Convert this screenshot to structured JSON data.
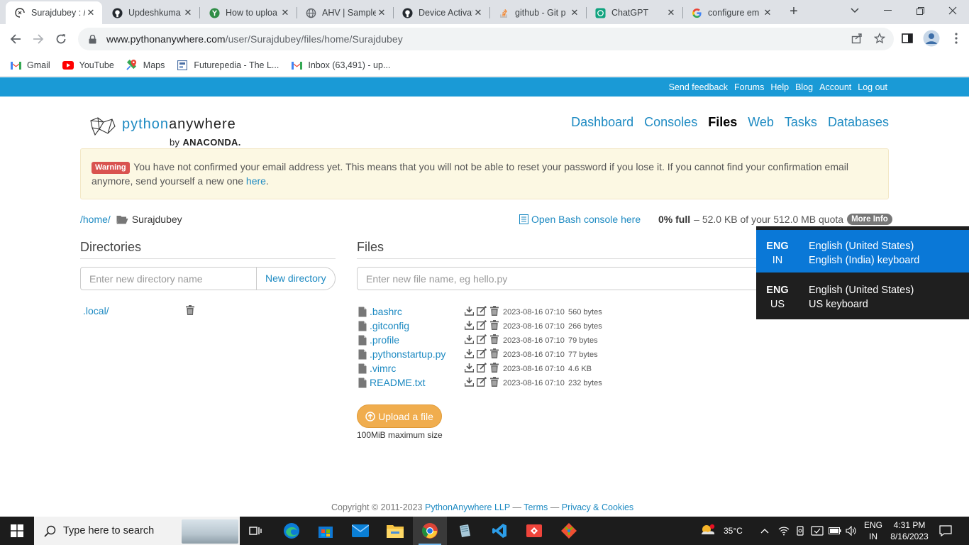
{
  "browser": {
    "tabs": [
      {
        "title": "Surajdubey : /",
        "favicon": "pythonanywhere-icon",
        "active": true
      },
      {
        "title": "Updeshkuma",
        "favicon": "github-icon"
      },
      {
        "title": "How to uploa",
        "favicon": "green-leaf-icon"
      },
      {
        "title": "AHV | Sample",
        "favicon": "globe-icon"
      },
      {
        "title": "Device Activat",
        "favicon": "github-icon"
      },
      {
        "title": "github - Git p",
        "favicon": "stackoverflow-icon"
      },
      {
        "title": "ChatGPT",
        "favicon": "chatgpt-icon"
      },
      {
        "title": "configure em",
        "favicon": "google-icon"
      }
    ],
    "new_tab": "+",
    "url_host": "www.pythonanywhere.com",
    "url_path": "/user/Surajdubey/files/home/Surajdubey",
    "bookmarks": [
      {
        "label": "Gmail",
        "icon": "gmail-icon"
      },
      {
        "label": "YouTube",
        "icon": "youtube-icon"
      },
      {
        "label": "Maps",
        "icon": "maps-icon"
      },
      {
        "label": "Futurepedia - The L...",
        "icon": "futurepedia-icon"
      },
      {
        "label": "Inbox (63,491) - up...",
        "icon": "gmail-icon"
      }
    ]
  },
  "topbar": {
    "links": [
      "Send feedback",
      "Forums",
      "Help",
      "Blog",
      "Account",
      "Log out"
    ]
  },
  "logo": {
    "python": "python",
    "anywhere": "anywhere",
    "by": "by",
    "brand": "ANACONDA."
  },
  "nav": {
    "items": [
      "Dashboard",
      "Consoles",
      "Files",
      "Web",
      "Tasks",
      "Databases"
    ],
    "current": "Files"
  },
  "warning": {
    "badge": "Warning",
    "text": "You have not confirmed your email address yet. This means that you will not be able to reset your password if you lose it. If you cannot find your confirmation email anymore, send yourself a new one",
    "link": "here",
    "end": "."
  },
  "path": {
    "root": "/home/",
    "current": "Surajdubey"
  },
  "bash_link": "Open Bash console here",
  "quota": {
    "percent": "0% full",
    "dash": "–",
    "detail": "52.0 KB of your 512.0 MB quota",
    "more_info": "More Info"
  },
  "directories": {
    "heading": "Directories",
    "placeholder": "Enter new directory name",
    "button": "New directory",
    "items": [
      ".local/"
    ]
  },
  "files": {
    "heading": "Files",
    "placeholder": "Enter new file name, eg hello.py",
    "items": [
      {
        "name": ".bashrc",
        "date": "2023-08-16 07:10",
        "size": "560 bytes"
      },
      {
        "name": ".gitconfig",
        "date": "2023-08-16 07:10",
        "size": "266 bytes"
      },
      {
        "name": ".profile",
        "date": "2023-08-16 07:10",
        "size": "79 bytes"
      },
      {
        "name": ".pythonstartup.py",
        "date": "2023-08-16 07:10",
        "size": "77 bytes"
      },
      {
        "name": ".vimrc",
        "date": "2023-08-16 07:10",
        "size": "4.6 KB"
      },
      {
        "name": "README.txt",
        "date": "2023-08-16 07:10",
        "size": "232 bytes"
      }
    ],
    "upload": "Upload a file",
    "max_size": "100MiB maximum size"
  },
  "footer": {
    "copyright": "Copyright © 2011-2023",
    "company": "PythonAnywhere LLP",
    "sep1": "—",
    "terms": "Terms",
    "sep2": "—",
    "privacy": "Privacy & Cookies"
  },
  "language_popup": {
    "options": [
      {
        "code": "ENG",
        "region": "IN",
        "language": "English (United States)",
        "keyboard": "English (India) keyboard",
        "selected": true
      },
      {
        "code": "ENG",
        "region": "US",
        "language": "English (United States)",
        "keyboard": "US keyboard",
        "selected": false
      }
    ]
  },
  "taskbar": {
    "search_placeholder": "Type here to search",
    "weather": "35°C",
    "lang_code": "ENG",
    "lang_region": "IN",
    "time": "4:31 PM",
    "date": "8/16/2023"
  },
  "colors": {
    "pa_blue": "#1a9ad6",
    "link_blue": "#1d8ac2",
    "warning_bg": "#fcf8e3",
    "upload_orange": "#f0ad4e",
    "lang_selected": "#0a78d7"
  }
}
